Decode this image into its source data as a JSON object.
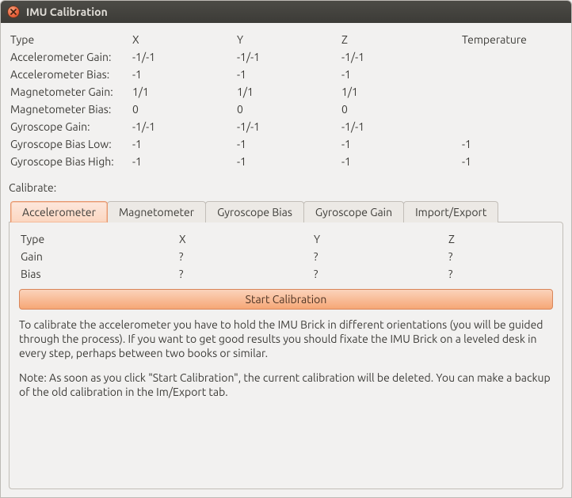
{
  "window": {
    "title": "IMU Calibration"
  },
  "colheaders": {
    "type": "Type",
    "x": "X",
    "y": "Y",
    "z": "Z",
    "temp": "Temperature"
  },
  "rows": {
    "acc_gain": {
      "label": "Accelerometer Gain:",
      "x": "-1/-1",
      "y": "-1/-1",
      "z": "-1/-1",
      "t": ""
    },
    "acc_bias": {
      "label": "Accelerometer Bias:",
      "x": "-1",
      "y": "-1",
      "z": "-1",
      "t": ""
    },
    "mag_gain": {
      "label": "Magnetometer Gain:",
      "x": "1/1",
      "y": "1/1",
      "z": "1/1",
      "t": ""
    },
    "mag_bias": {
      "label": "Magnetometer Bias:",
      "x": "0",
      "y": "0",
      "z": "0",
      "t": ""
    },
    "gyro_gain": {
      "label": "Gyroscope Gain:",
      "x": "-1/-1",
      "y": "-1/-1",
      "z": "-1/-1",
      "t": ""
    },
    "gyro_lo": {
      "label": "Gyroscope Bias Low:",
      "x": "-1",
      "y": "-1",
      "z": "-1",
      "t": "-1"
    },
    "gyro_hi": {
      "label": "Gyroscope Bias High:",
      "x": "-1",
      "y": "-1",
      "z": "-1",
      "t": "-1"
    }
  },
  "calibrate_label": "Calibrate:",
  "tabs": {
    "acc": "Accelerometer",
    "mag": "Magnetometer",
    "gbias": "Gyroscope Bias",
    "ggain": "Gyroscope Gain",
    "imp": "Import/Export"
  },
  "inner": {
    "hdr": {
      "type": "Type",
      "x": "X",
      "y": "Y",
      "z": "Z"
    },
    "gain": {
      "label": "Gain",
      "x": "?",
      "y": "?",
      "z": "?"
    },
    "bias": {
      "label": "Bias",
      "x": "?",
      "y": "?",
      "z": "?"
    }
  },
  "start_btn": "Start Calibration",
  "desc": {
    "p1": "To calibrate the accelerometer you have to hold the IMU Brick in different orientations (you will be guided through the process). If you want to get good results you should fixate the IMU Brick on a leveled desk in every step, perhaps between two books or similar.",
    "p2": "Note: As soon as you click \"Start Calibration\", the current calibration will be deleted. You can make a backup of the old calibration in the Im/Export tab."
  }
}
